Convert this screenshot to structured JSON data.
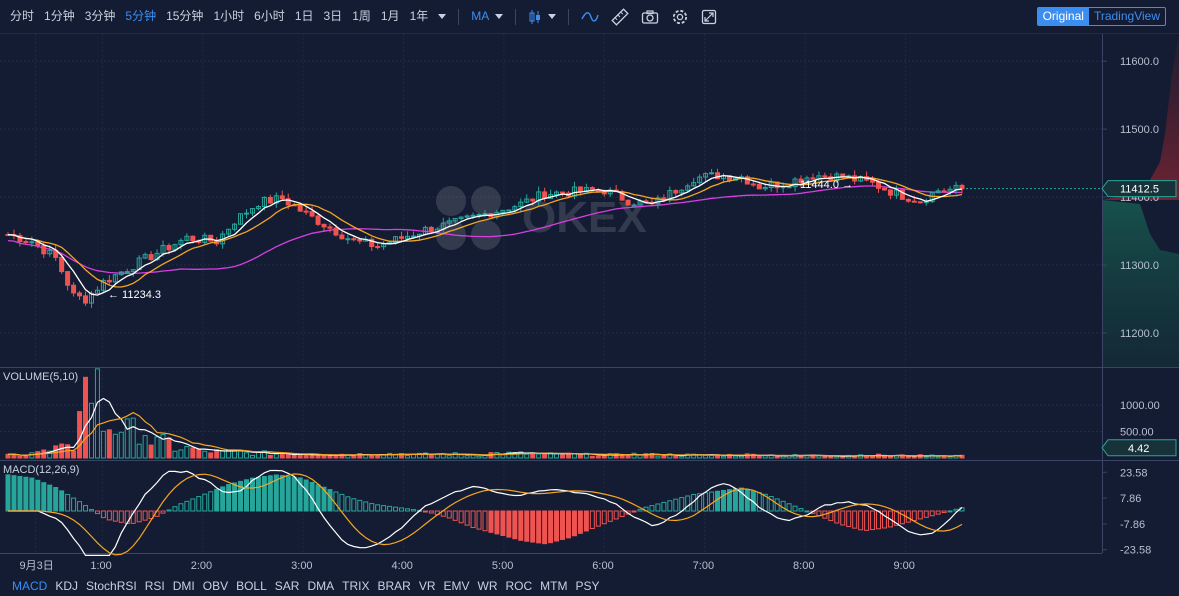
{
  "toolbar": {
    "timeframes": [
      "分时",
      "1分钟",
      "3分钟",
      "5分钟",
      "15分钟",
      "1小时",
      "6小时",
      "1日",
      "3日",
      "1周",
      "1月",
      "1年"
    ],
    "active_timeframe": "5分钟",
    "indicator_label": "MA"
  },
  "mode": {
    "original": "Original",
    "tradingview": "TradingView",
    "active": "Original"
  },
  "watermark": "OKEX",
  "price_axis": [
    "11600.0",
    "11500.0",
    "11400.0",
    "11300.0",
    "11200.0"
  ],
  "current_price": "11412.5",
  "high_annotation": "11444.0 →",
  "low_annotation": "← 11234.3",
  "volume_panel": {
    "title": "VOLUME(5,10)",
    "axis": [
      "1000.00",
      "500.00"
    ],
    "current": "4.42"
  },
  "macd_panel": {
    "title": "MACD(12,26,9)",
    "axis": [
      "23.58",
      "7.86",
      "-7.86",
      "-23.58"
    ]
  },
  "time_axis": [
    "9月3日",
    "1:00",
    "2:00",
    "3:00",
    "4:00",
    "5:00",
    "6:00",
    "7:00",
    "8:00",
    "9:00"
  ],
  "indicators": [
    "MACD",
    "KDJ",
    "StochRSI",
    "RSI",
    "DMI",
    "OBV",
    "BOLL",
    "SAR",
    "DMA",
    "TRIX",
    "BRAR",
    "VR",
    "EMV",
    "WR",
    "ROC",
    "MTM",
    "PSY"
  ],
  "active_indicator": "MACD",
  "colors": {
    "up": "#26a69a",
    "down": "#ef5350",
    "accent": "#3b8ef0",
    "ma5": "#ffffff",
    "ma10": "#f5a623",
    "ma30": "#d63fe0"
  },
  "chart_data": {
    "type": "candlestick",
    "x_range": [
      "9月3日 00:00",
      "9月3日 09:35"
    ],
    "y_range": [
      11150,
      11640
    ],
    "high": 11444.0,
    "low": 11234.3,
    "last": 11412.5,
    "close_path": [
      [
        0,
        11345
      ],
      [
        4,
        11335
      ],
      [
        8,
        11310
      ],
      [
        11,
        11255
      ],
      [
        13,
        11250
      ],
      [
        16,
        11275
      ],
      [
        20,
        11295
      ],
      [
        25,
        11318
      ],
      [
        30,
        11340
      ],
      [
        35,
        11335
      ],
      [
        38,
        11365
      ],
      [
        42,
        11392
      ],
      [
        46,
        11398
      ],
      [
        50,
        11375
      ],
      [
        54,
        11355
      ],
      [
        58,
        11335
      ],
      [
        62,
        11328
      ],
      [
        66,
        11340
      ],
      [
        70,
        11352
      ],
      [
        75,
        11362
      ],
      [
        80,
        11375
      ],
      [
        86,
        11390
      ],
      [
        90,
        11405
      ],
      [
        95,
        11408
      ],
      [
        100,
        11410
      ],
      [
        104,
        11395
      ],
      [
        108,
        11388
      ],
      [
        111,
        11405
      ],
      [
        115,
        11428
      ],
      [
        119,
        11432
      ],
      [
        123,
        11430
      ],
      [
        126,
        11416
      ],
      [
        130,
        11420
      ],
      [
        135,
        11432
      ],
      [
        140,
        11430
      ],
      [
        145,
        11420
      ],
      [
        149,
        11405
      ],
      [
        153,
        11395
      ],
      [
        156,
        11410
      ],
      [
        160,
        11412
      ]
    ],
    "volume_5min": [
      60,
      120,
      180,
      1300,
      600,
      520,
      300,
      180,
      120,
      110,
      90,
      80,
      85,
      75,
      70,
      95,
      80,
      65,
      70,
      60,
      90,
      85,
      70,
      65,
      60,
      55,
      70,
      60,
      55,
      50,
      55,
      60,
      50,
      45,
      48,
      55,
      50,
      40,
      42,
      45
    ],
    "macd_hist": [
      22,
      20,
      14,
      5,
      -5,
      -8,
      -4,
      4,
      10,
      16,
      20,
      22,
      20,
      14,
      8,
      4,
      2,
      0,
      -4,
      -10,
      -14,
      -18,
      -20,
      -16,
      -10,
      -4,
      2,
      6,
      10,
      12,
      14,
      10,
      4,
      -2,
      -8,
      -12,
      -10,
      -6,
      -2,
      2
    ]
  }
}
